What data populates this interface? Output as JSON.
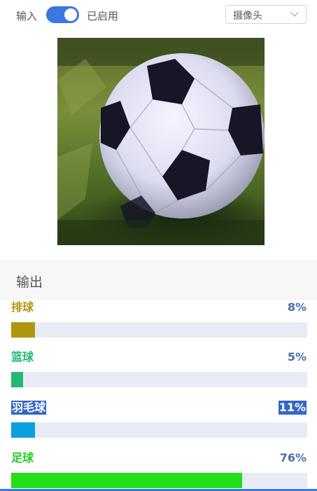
{
  "input_bar": {
    "input_label": "输入",
    "toggle_state": "已启用",
    "toggle_on": true,
    "source_value": "摄像头"
  },
  "output": {
    "title": "输出"
  },
  "results": [
    {
      "label": "排球",
      "percent_text": "8%",
      "value": 0.08,
      "label_color": "#b0960f",
      "bar_color": "#b0960f",
      "highlighted": false
    },
    {
      "label": "篮球",
      "percent_text": "5%",
      "value": 0.04,
      "label_color": "#1fb874",
      "bar_color": "#1fb874",
      "highlighted": false
    },
    {
      "label": "羽毛球",
      "percent_text": "11%",
      "value": 0.08,
      "label_color": "#ffffff",
      "bar_color": "#0c9fe0",
      "highlighted": true
    },
    {
      "label": "足球",
      "percent_text": "76%",
      "value": 0.78,
      "label_color": "#22cc22",
      "bar_color": "#22dd1a",
      "highlighted": false
    }
  ],
  "colors": {
    "accent": "#3a78e0",
    "percent_text": "#4a6fb0",
    "track": "#e9ecf5"
  }
}
